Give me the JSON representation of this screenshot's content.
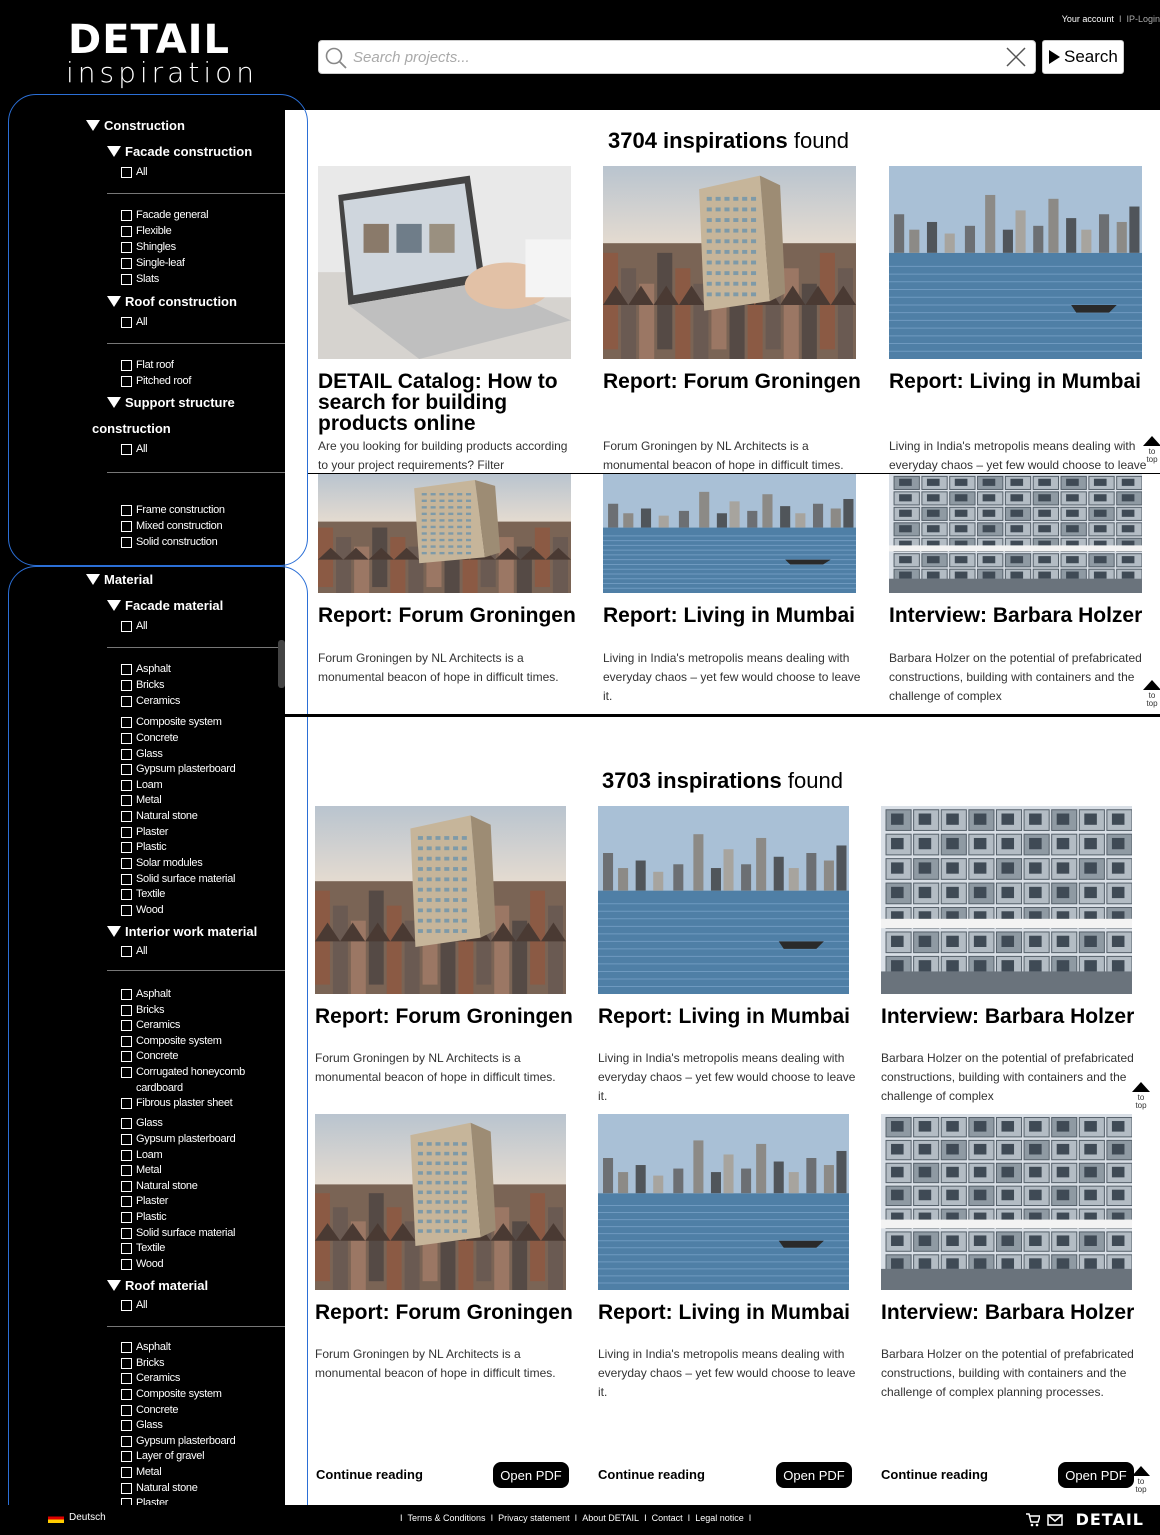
{
  "header": {
    "logo_top": "DETAIL",
    "logo_bottom": "inspiration",
    "account": "Your account",
    "account_sep": "I",
    "ip_login": "IP-Login",
    "search_placeholder": "Search projects...",
    "search_button": "Search"
  },
  "sidebar": {
    "construction": "Construction",
    "facade_construction": "Facade construction",
    "roof_construction": "Roof construction",
    "support_structure_1": "Support structure",
    "support_structure_2": "construction",
    "all": "All",
    "facade_items": [
      "Facade general",
      "Flexible",
      "Shingles",
      "Single-leaf",
      "Slats"
    ],
    "roof_items": [
      "Flat roof",
      "Pitched roof"
    ],
    "support_items": [
      "Frame construction",
      "Mixed construction",
      "Solid construction"
    ],
    "material": "Material",
    "facade_material": "Facade material",
    "facade_material_items": [
      "Asphalt",
      "Bricks",
      "Ceramics",
      "Composite system",
      "Concrete",
      "Glass",
      "Gypsum plasterboard",
      "Loam",
      "Metal",
      "Natural stone",
      "Plaster",
      "Plastic",
      "Solar modules",
      "Solid surface material",
      "Textile",
      "Wood"
    ],
    "interior_material": "Interior work material",
    "interior_items": [
      "Asphalt",
      "Bricks",
      "Ceramics",
      "Composite system",
      "Concrete",
      "Corrugated honeycomb",
      "cardboard",
      "Fibrous plaster sheet",
      "Glass",
      "Gypsum plasterboard",
      "Loam",
      "Metal",
      "Natural stone",
      "Plaster",
      "Plastic",
      "Solid surface material",
      "Textile",
      "Wood"
    ],
    "roof_material": "Roof material",
    "roof_material_items": [
      "Asphalt",
      "Bricks",
      "Ceramics",
      "Composite system",
      "Concrete",
      "Glass",
      "Gypsum plasterboard",
      "Layer of gravel",
      "Metal",
      "Natural stone",
      "Plaster"
    ]
  },
  "results_top": {
    "count": "3704 inspirations",
    "found": "found",
    "cards": [
      {
        "title": "DETAIL Catalog: How to search for building products online",
        "desc": "Are you looking for building products according to your project requirements? Filter"
      },
      {
        "title": "Report: Forum Groningen",
        "desc": "Forum Groningen by NL Architects is a monumental beacon of hope in difficult times."
      },
      {
        "title": "Report: Living in Mumbai",
        "desc": "Living in India's metropolis means dealing with everyday chaos – yet few would choose to leave it."
      },
      {
        "title": "Report: Forum Groningen",
        "desc": "Forum Groningen by NL Architects is a monumental beacon of hope in difficult times."
      },
      {
        "title": "Report: Living in Mumbai",
        "desc": "Living in India's metropolis means dealing with everyday chaos – yet few would choose to leave it."
      },
      {
        "title": "Interview: Barbara Holzer",
        "desc": "Barbara Holzer on the potential of prefabricated constructions, building with containers and the challenge of complex"
      }
    ]
  },
  "results_bottom": {
    "count": "3703 inspirations",
    "found": "found",
    "cards": [
      {
        "title": "Report: Forum Groningen",
        "desc": "Forum Groningen by NL Architects is a monumental beacon of hope in difficult times."
      },
      {
        "title": "Report: Living in Mumbai",
        "desc": "Living in India's metropolis means dealing with everyday chaos – yet few would choose to leave it."
      },
      {
        "title": "Interview: Barbara Holzer",
        "desc": "Barbara Holzer on the potential of prefabricated constructions, building with containers and the challenge of complex"
      },
      {
        "title": "Report: Forum Groningen",
        "desc": "Forum Groningen by NL Architects is a monumental beacon of hope in difficult times."
      },
      {
        "title": "Report: Living in Mumbai",
        "desc": "Living in India's metropolis means dealing with everyday chaos – yet few would choose to leave it."
      },
      {
        "title": "Interview: Barbara Holzer",
        "desc": "Barbara Holzer on the potential of prefabricated constructions, building with containers and the challenge of complex planning processes."
      }
    ],
    "continue_reading": "Continue reading",
    "open_pdf": "Open PDF"
  },
  "to_top": [
    "to",
    "top"
  ],
  "footer": {
    "language": "Deutsch",
    "links": [
      "Terms & Conditions",
      "Privacy statement",
      "About DETAIL",
      "Contact",
      "Legal notice"
    ],
    "sep": "I",
    "logo": "DETAIL"
  },
  "colors": {
    "accent_blue": "#2b6fd6",
    "sidebar_bg": "#000000",
    "header_bg": "#000000"
  },
  "icons": [
    "search-icon",
    "clear-icon",
    "caret-down-icon",
    "caret-right-icon",
    "up-arrow-icon",
    "cart-icon",
    "mail-icon",
    "flag-icon"
  ]
}
